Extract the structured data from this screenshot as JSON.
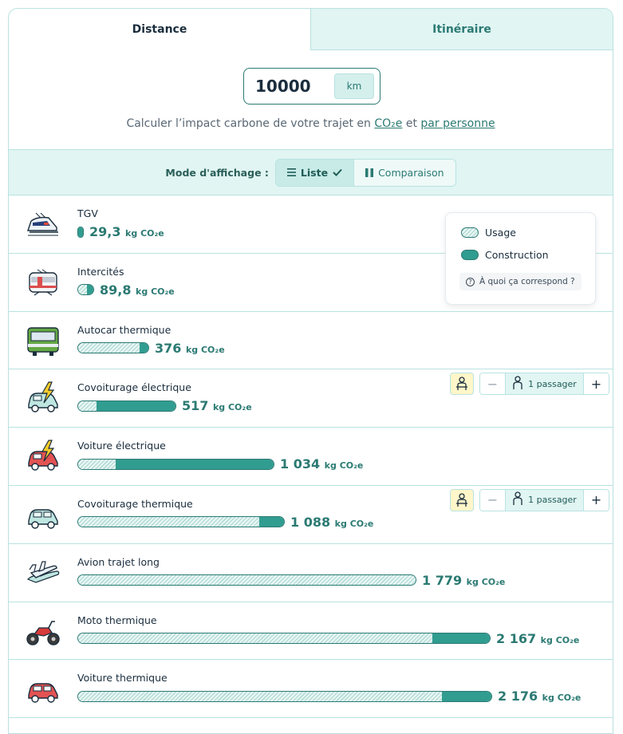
{
  "tabs": [
    {
      "label": "Distance",
      "active": true
    },
    {
      "label": "Itinéraire",
      "active": false
    }
  ],
  "distance": {
    "value": "10000",
    "unit": "km"
  },
  "calc_text": {
    "before": "Calculer l’impact carbone de votre trajet en ",
    "co2_link": "CO₂e",
    "middle": " et ",
    "person_link": "par personne"
  },
  "mode": {
    "label": "Mode d'affichage :",
    "options": [
      {
        "label": "Liste",
        "active": true
      },
      {
        "label": "Comparaison",
        "active": false
      }
    ]
  },
  "legend": {
    "usage": "Usage",
    "construction": "Construction",
    "help": "À quoi ça correspond ?"
  },
  "unit_label": "kg CO₂e",
  "passenger": {
    "label": "1 passager",
    "minus": "−",
    "plus": "+"
  },
  "max_value": 2176,
  "transports": [
    {
      "name": "TGV",
      "value": "29,3",
      "total": 29.3,
      "usage_frac": 0.0,
      "icon": "train-tgv-icon",
      "passenger": false
    },
    {
      "name": "Intercités",
      "value": "89,8",
      "total": 89.8,
      "usage_frac": 0.6,
      "icon": "train-intercites-icon",
      "passenger": false
    },
    {
      "name": "Autocar thermique",
      "value": "376",
      "total": 376,
      "usage_frac": 0.87,
      "icon": "bus-icon",
      "passenger": false
    },
    {
      "name": "Covoiturage électrique",
      "value": "517",
      "total": 517,
      "usage_frac": 0.19,
      "icon": "electric-car-pool-icon",
      "passenger": true
    },
    {
      "name": "Voiture électrique",
      "value": "1 034",
      "total": 1034,
      "usage_frac": 0.19,
      "icon": "electric-car-icon",
      "passenger": false
    },
    {
      "name": "Covoiturage thermique",
      "value": "1 088",
      "total": 1088,
      "usage_frac": 0.88,
      "icon": "car-pool-icon",
      "passenger": true
    },
    {
      "name": "Avion trajet long",
      "value": "1 779",
      "total": 1779,
      "usage_frac": 1.0,
      "icon": "plane-icon",
      "passenger": false
    },
    {
      "name": "Moto thermique",
      "value": "2 167",
      "total": 2167,
      "usage_frac": 0.86,
      "icon": "motorbike-icon",
      "passenger": false
    },
    {
      "name": "Voiture thermique",
      "value": "2 176",
      "total": 2176,
      "usage_frac": 0.88,
      "icon": "car-icon",
      "passenger": false
    }
  ],
  "colors": {
    "accent": "#2b7a73",
    "construction": "#319c90",
    "light": "#e1f5f3"
  }
}
